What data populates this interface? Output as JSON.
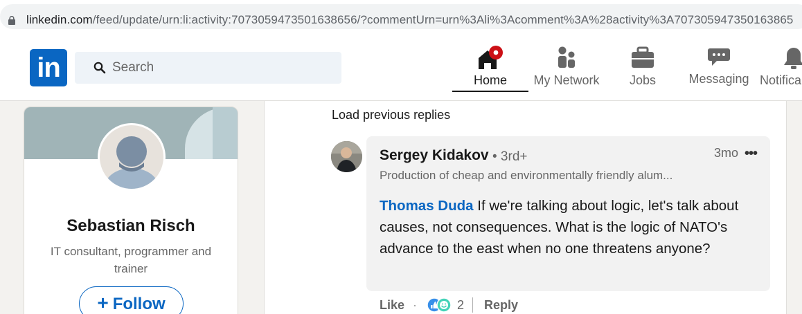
{
  "browser": {
    "url_host": "linkedin.com",
    "url_path": "/feed/update/urn:li:activity:7073059473501638656/?commentUrn=urn%3Ali%3Acomment%3A%28activity%3A707305947350163865"
  },
  "header": {
    "logo_text": "in",
    "search_placeholder": "Search",
    "nav": [
      {
        "label": "Home",
        "icon": "home-icon",
        "active": true
      },
      {
        "label": "My Network",
        "icon": "network-icon"
      },
      {
        "label": "Jobs",
        "icon": "briefcase-icon"
      },
      {
        "label": "Messaging",
        "icon": "messaging-icon"
      },
      {
        "label": "Notifica",
        "icon": "bell-icon"
      }
    ]
  },
  "profile": {
    "name": "Sebastian Risch",
    "headline": "IT consultant, programmer and trainer",
    "follow_plus": "+",
    "follow_label": "Follow"
  },
  "feed": {
    "load_previous": "Load previous replies",
    "comment": {
      "author": "Sergey Kidakov",
      "degree": "• 3rd+",
      "time": "3mo",
      "more": "•••",
      "author_headline": "Production of cheap and environmentally friendly alum...",
      "mention": "Thomas Duda",
      "text": " If we're talking about logic, let's talk about causes, not consequences. What is the logic of NATO's advance to the east when no one threatens anyone?"
    },
    "actions": {
      "like": "Like",
      "dot": "·",
      "reaction_count": "2",
      "reply": "Reply"
    }
  },
  "colors": {
    "brand": "#0a66c2",
    "notification_badge": "#cc1016"
  }
}
